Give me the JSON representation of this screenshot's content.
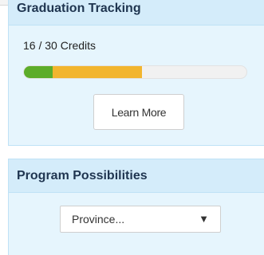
{
  "graduation": {
    "title": "Graduation Tracking",
    "credits_text": "16 / 30 Credits",
    "progress": {
      "segments": [
        {
          "name": "completed",
          "fraction": 0.13,
          "color": "#5cad2a"
        },
        {
          "name": "in_progress",
          "fraction": 0.4,
          "color": "#f2b52e"
        },
        {
          "name": "remaining",
          "fraction": 0.47,
          "color": "#f1f1f1"
        }
      ]
    },
    "learn_more_label": "Learn More"
  },
  "program": {
    "title": "Program Possibilities",
    "province_select": {
      "selected": "Province...",
      "arrow": "▼"
    }
  },
  "colors": {
    "panel_bg": "#e6f5fd",
    "header_bg": "#d4ecfa",
    "border": "#bfe2f6",
    "title_text": "#1f3550"
  }
}
